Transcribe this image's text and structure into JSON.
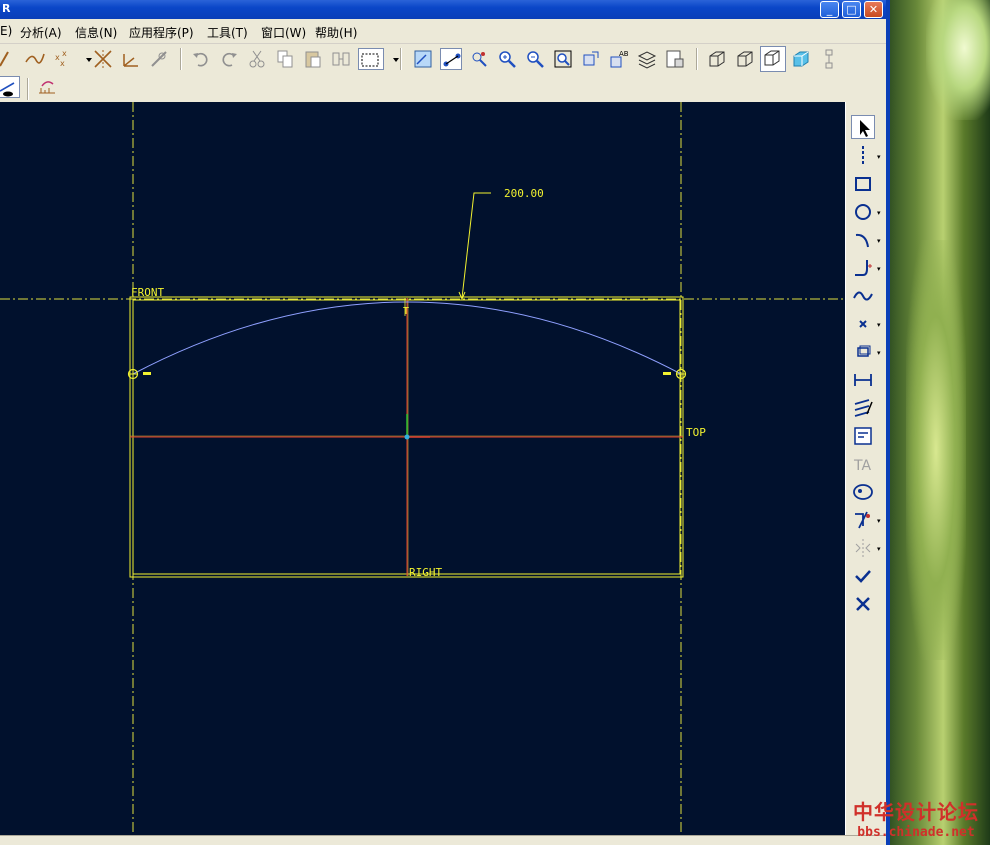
{
  "title_bar": {
    "title_fragment": "R"
  },
  "window_buttons": {
    "minimize": "_",
    "maximize": "□",
    "close": "✕"
  },
  "menu": {
    "items": [
      "分析(A)",
      "信息(N)",
      "应用程序(P)",
      "工具(T)",
      "窗口(W)",
      "帮助(H)"
    ],
    "left_fragment": "E)"
  },
  "sketch": {
    "dimension": "200.00",
    "datum_front": "FRONT",
    "datum_top": "TOP",
    "datum_right": "RIGHT",
    "tangent_marker": "T"
  },
  "colors": {
    "background": "#01112d",
    "datum": "#f2f230",
    "arc": "#8fa0ff",
    "reference_red": "#e04030"
  },
  "watermark": {
    "line1": "中华设计论坛",
    "line2": "bbs.chinade.net"
  }
}
